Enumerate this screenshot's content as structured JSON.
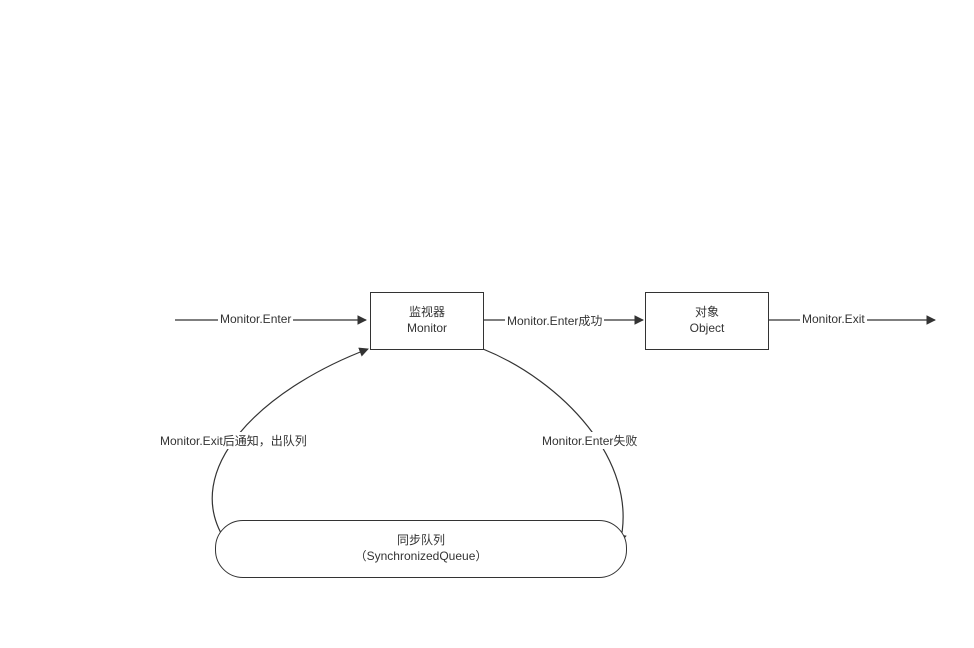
{
  "nodes": {
    "monitor": {
      "line1": "监视器",
      "line2": "Monitor"
    },
    "object": {
      "line1": "对象",
      "line2": "Object"
    },
    "queue": {
      "line1": "同步队列",
      "line2": "（SynchronizedQueue）"
    }
  },
  "edges": {
    "enter": "Monitor.Enter",
    "enterSuccess": "Monitor.Enter成功",
    "exit": "Monitor.Exit",
    "enterFail": "Monitor.Enter失败",
    "exitNotify": "Monitor.Exit后通知，出队列"
  }
}
